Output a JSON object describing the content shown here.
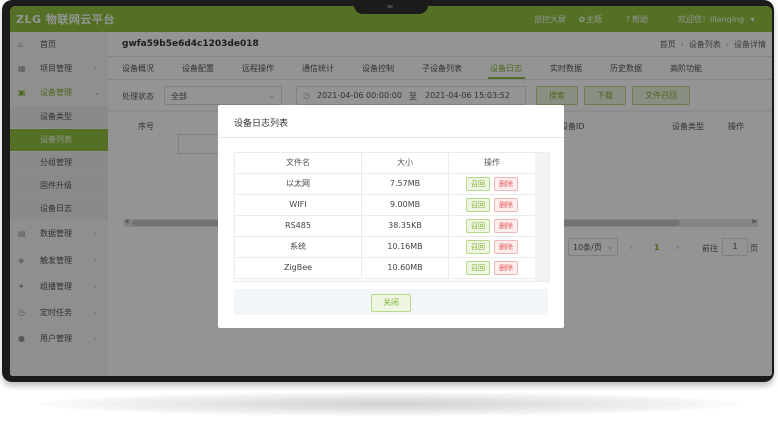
{
  "topbar": {
    "logo": "ZLG 物联网云平台",
    "nav": [
      {
        "label": "监控大屏",
        "icon": "monitor-icon"
      },
      {
        "label": "主题",
        "icon": "theme-icon"
      },
      {
        "label": "帮助",
        "icon": "help-icon"
      }
    ],
    "welcome": "欢迎您！lilanqing",
    "dropdown_icon": "chevron-down-icon",
    "accent_color": "#8fc23f"
  },
  "sidebar": {
    "items": [
      {
        "label": "首页",
        "icon": "home-icon"
      },
      {
        "label": "项目管理",
        "icon": "project-icon"
      },
      {
        "label": "设备管理",
        "icon": "device-icon",
        "expanded": true,
        "children": [
          "设备类型",
          "设备列表",
          "分组管理",
          "固件升级",
          "设备日志"
        ],
        "active_child": "设备列表"
      },
      {
        "label": "数据管理",
        "icon": "data-icon"
      },
      {
        "label": "触发管理",
        "icon": "trigger-icon"
      },
      {
        "label": "组播管理",
        "icon": "multicast-icon"
      },
      {
        "label": "定时任务",
        "icon": "timer-icon"
      },
      {
        "label": "用户管理",
        "icon": "user-icon"
      }
    ]
  },
  "header": {
    "device_id": "gwfa59b5e6d4c1203de018",
    "breadcrumb": [
      "首页",
      "设备列表",
      "设备详情"
    ]
  },
  "tabs": {
    "items": [
      "设备概况",
      "设备配置",
      "远程操作",
      "通信统计",
      "设备控制",
      "子设备列表",
      "设备日志",
      "实时数据",
      "历史数据",
      "高阶功能"
    ],
    "active": "设备日志"
  },
  "filter": {
    "status_label": "处理状态",
    "status_value": "全部",
    "date_start": "2021-04-06 00:00:00",
    "date_sep": "至",
    "date_end": "2021-04-06 15:03:52",
    "search_label": "搜索",
    "download_label": "下载",
    "recall_label": "文件召回"
  },
  "table": {
    "headers": [
      "序号",
      "设备ID",
      "设备类型",
      "操作"
    ]
  },
  "pagination": {
    "page_size": "10条/页",
    "current_page": "1",
    "goto_label": "前往",
    "goto_value": "1",
    "page_suffix": "页"
  },
  "modal": {
    "title": "设备日志列表",
    "columns": [
      "文件名",
      "大小",
      "操作"
    ],
    "files": [
      {
        "name": "以太网",
        "size": "7.57MB"
      },
      {
        "name": "WIFI",
        "size": "9.00MB"
      },
      {
        "name": "RS485",
        "size": "38.35KB"
      },
      {
        "name": "系统",
        "size": "10.16MB"
      },
      {
        "name": "ZigBee",
        "size": "10.60MB"
      }
    ],
    "recall_label": "召回",
    "delete_label": "删除",
    "close_label": "关闭"
  }
}
